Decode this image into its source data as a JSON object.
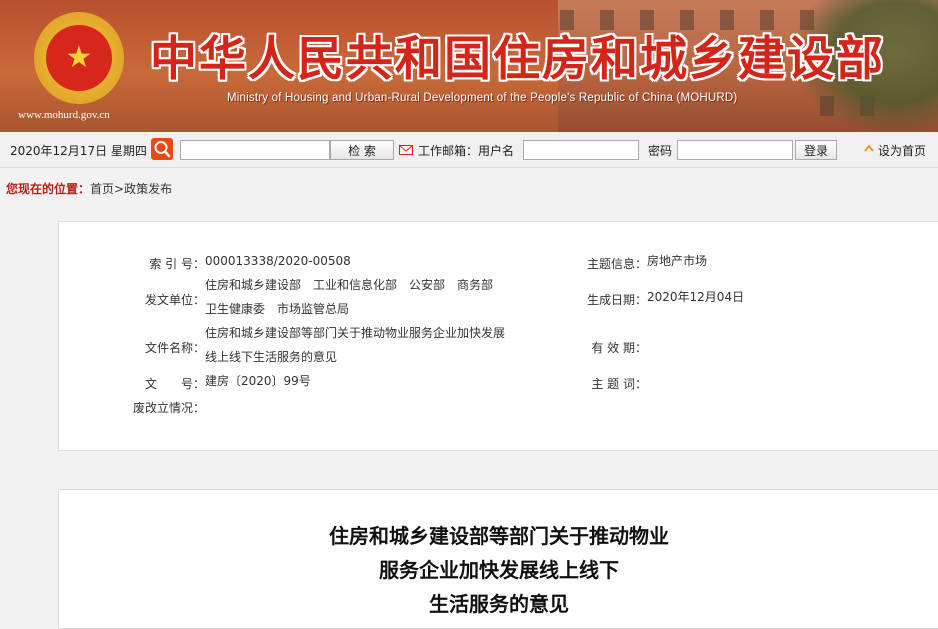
{
  "header": {
    "title_cn": "中华人民共和国住房和城乡建设部",
    "title_en": "Ministry of Housing and Urban-Rural Development of the People's Republic of China (MOHURD)",
    "site_url": "www.mohurd.gov.cn",
    "emblem_icon": "national-emblem-icon"
  },
  "toolbar": {
    "date": "2020年12月17日 星期四",
    "search_placeholder": "",
    "search_button": "检    索",
    "mail_label": "工作邮箱：用户名",
    "username_value": "",
    "password_label": "密码",
    "password_value": "",
    "login_button": "登录",
    "homepage_link": "设为首页"
  },
  "location": {
    "label": "您现在的位置：",
    "path": "首页>政策发布"
  },
  "info": {
    "index_label": "索 引 号：",
    "index_value": "000013338/2020-00508",
    "issuer_label": "发文单位：",
    "issuer_line1": "住房和城乡建设部　工业和信息化部　公安部　商务部",
    "issuer_line2": "卫生健康委　市场监管总局",
    "docname_label": "文件名称：",
    "docname_line1": "住房和城乡建设部等部门关于推动物业服务企业加快发展",
    "docname_line2": "线上线下生活服务的意见",
    "docno_label": "文　　号：",
    "docno_value": "建房〔2020〕99号",
    "status_label": "废改立情况：",
    "status_value": "",
    "topic_label": "主题信息：",
    "topic_value": "房地产市场",
    "date_label": "生成日期：",
    "date_value": "2020年12月04日",
    "validity_label": "有 效 期：",
    "validity_value": "",
    "keywords_label": "主 题 词：",
    "keywords_value": ""
  },
  "article": {
    "title_line1": "住房和城乡建设部等部门关于推动物业",
    "title_line2": "服务企业加快发展线上线下",
    "title_line3": "生活服务的意见"
  },
  "colors": {
    "brand_red": "#d4251b",
    "banner": "#c0603a",
    "search_orange": "#e84b10"
  }
}
